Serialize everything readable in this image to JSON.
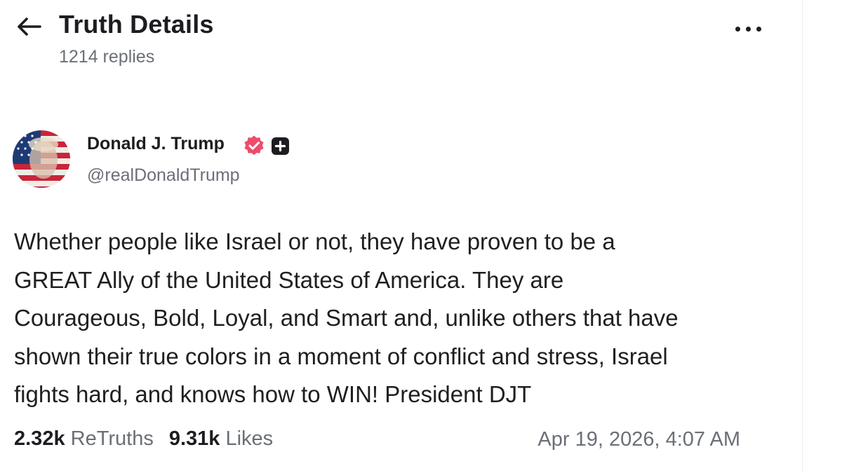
{
  "header": {
    "title": "Truth Details",
    "replies": "1214 replies",
    "back_icon": "arrow-left-icon",
    "more_icon": "more-horizontal-icon"
  },
  "author": {
    "name": "Donald J. Trump",
    "handle": "@realDonaldTrump",
    "verified_icon": "verified-badge-icon",
    "verified_color": "#ec4d6a",
    "plus_icon": "plus-badge-icon"
  },
  "post": {
    "lines": [
      "Whether people like Israel or not, they have proven to be a",
      "GREAT Ally of the United States of America. They are",
      "Courageous, Bold, Loyal, and Smart and, unlike others that have",
      "shown their true colors in a moment of conflict and stress, Israel",
      "fights hard, and knows how to WIN! President DJT"
    ]
  },
  "stats": {
    "retruths_count": "2.32k",
    "retruths_label": "ReTruths",
    "likes_count": "9.31k",
    "likes_label": "Likes",
    "timestamp": "Apr 19, 2026, 4:07 AM"
  },
  "colors": {
    "text_primary": "#1d1d21",
    "text_secondary": "#6b6f77",
    "divider": "#eceef1"
  }
}
